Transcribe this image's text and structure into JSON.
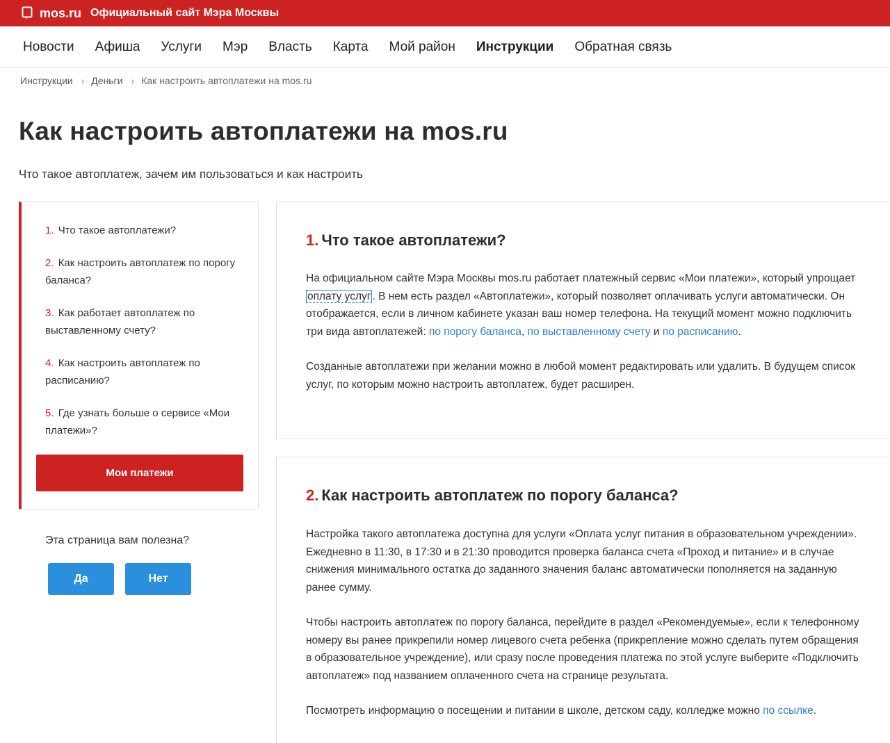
{
  "header": {
    "logo_icon": "map-pin-icon",
    "logo": "mos.ru",
    "site_title": "Официальный сайт Мэра Москвы",
    "accent_color": "#cc2222"
  },
  "nav": {
    "items": [
      "Новости",
      "Афиша",
      "Услуги",
      "Мэр",
      "Власть",
      "Карта",
      "Мой район",
      "Инструкции",
      "Обратная связь"
    ],
    "active": "Инструкции"
  },
  "breadcrumb": [
    "Инструкции",
    "Деньги",
    "Как настроить автоплатежи на mos.ru"
  ],
  "page": {
    "title": "Как настроить автоплатежи на mos.ru",
    "subtitle": "Что такое автоплатеж, зачем им пользоваться и как настроить"
  },
  "toc": {
    "items": [
      {
        "num": "1.",
        "label": "Что такое автоплатежи?"
      },
      {
        "num": "2.",
        "label": "Как настроить автоплатеж по порогу баланса?"
      },
      {
        "num": "3.",
        "label": "Как работает автоплатеж по выставленному счету?"
      },
      {
        "num": "4.",
        "label": "Как настроить автоплатеж по расписанию?"
      },
      {
        "num": "5.",
        "label": "Где узнать больше о сервисе «Мои платежи»?"
      }
    ],
    "button": "Мои платежи"
  },
  "feedback": {
    "question": "Эта страница вам полезна?",
    "yes": "Да",
    "no": "Нет",
    "button_color": "#2a8fdd"
  },
  "sections": [
    {
      "num": "1.",
      "heading": "Что такое автоплатежи?",
      "p1": {
        "a": "На официальном сайте Мэра Москвы mos.ru работает платежный сервис «Мои платежи», который упрощает ",
        "term": "оплату услуг",
        "b": ". В нем есть раздел «Автоплатежи», который позволяет оплачивать услуги автоматически. Он отображается, если в личном кабинете указан ваш номер телефона. На текущий момент можно подключить три вида автоплатежей: ",
        "link1": "по порогу баланса",
        "c": ", ",
        "link2": "по выставленному счету",
        "d": " и ",
        "link3": "по расписанию",
        "e": "."
      },
      "p2": "Созданные автоплатежи при желании можно в любой момент редактировать или удалить. В будущем список услуг, по которым можно настроить автоплатеж, будет расширен."
    },
    {
      "num": "2.",
      "heading": "Как настроить автоплатеж по порогу баланса?",
      "p1": "Настройка такого автоплатежа доступна для услуги «Оплата услуг питания в образовательном учреждении». Ежедневно в 11:30, в 17:30 и в 21:30 проводится проверка баланса счета «Проход и питание» и в случае снижения минимального остатка до заданного значения баланс автоматически пополняется на заданную ранее сумму.",
      "p2": "Чтобы настроить автоплатеж по порогу баланса, перейдите в раздел «Рекомендуемые», если к телефонному номеру вы ранее прикрепили номер лицевого счета ребенка (прикрепление можно сделать путем обращения в образовательное учреждение), или сразу после проведения платежа по этой услуге выберите «Подключить автоплатеж» под названием оплаченного счета на странице результата.",
      "p3": {
        "a": "Посмотреть информацию о посещении и питании в школе, детском саду, колледже можно ",
        "link": "по ссылке",
        "b": "."
      }
    }
  ]
}
